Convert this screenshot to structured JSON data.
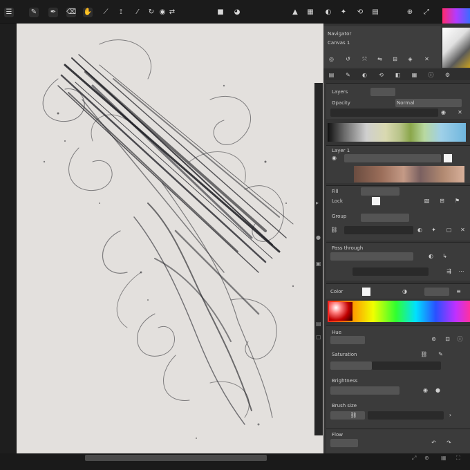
{
  "toolbar": {
    "icons": [
      "grid-icon",
      "brush-icon",
      "pen-icon",
      "eraser-icon",
      "smudge-icon",
      "select-icon",
      "view-icon",
      "layer-icon",
      "tool-icon",
      "shape-icon",
      "image-icon",
      "adjust-icon",
      "effects-icon",
      "settings-icon"
    ]
  },
  "navigator": {
    "title": "Navigator",
    "subtitle": "Canvas 1"
  },
  "layers": {
    "title": "Layers",
    "opacity_label": "Opacity",
    "blend_label": "Normal",
    "fill_label": "Fill",
    "lock_label": "Lock",
    "layer_name": "Layer 1",
    "group_label": "Group",
    "mode_label": "Pass through"
  },
  "color": {
    "title": "Color",
    "hex": "",
    "hue_label": "Hue",
    "sat_label": "Saturation",
    "bright_label": "Brightness",
    "brush_label": "Brush size",
    "flow_label": "Flow"
  },
  "theme": {
    "accent": "#ff2a6d",
    "canvas_bg": "#e3e0dd",
    "panel_bg": "#3b3b3b"
  }
}
